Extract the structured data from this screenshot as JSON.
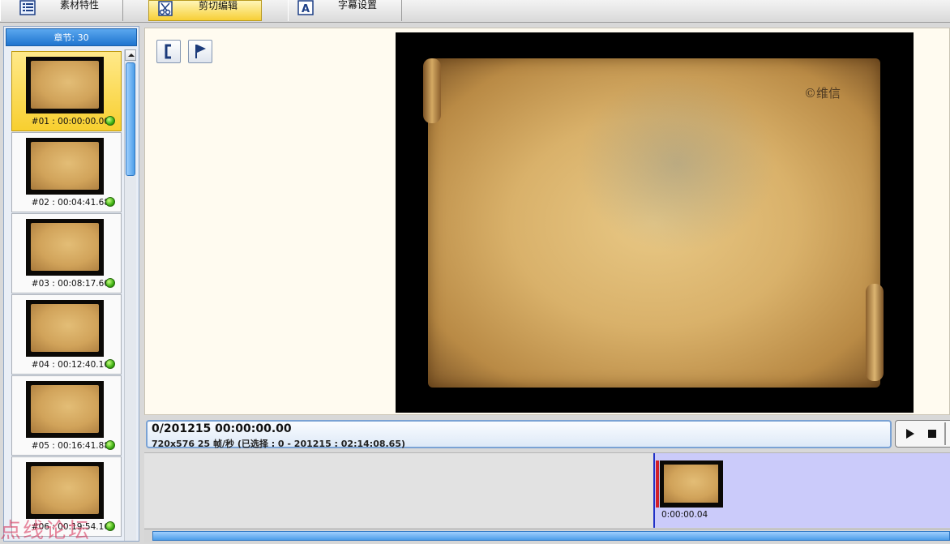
{
  "tabs": [
    {
      "label": "素材特性",
      "icon": "list-icon",
      "active": false
    },
    {
      "label": "剪切编辑",
      "icon": "scissors-edit-icon",
      "active": true
    },
    {
      "label": "字幕设置",
      "icon": "subtitle-a-icon",
      "active": false
    }
  ],
  "chapter_panel": {
    "header": "章节: 30",
    "items": [
      {
        "label": "#01 : 00:00:00.00",
        "selected": true
      },
      {
        "label": "#02 : 00:04:41.68",
        "selected": false
      },
      {
        "label": "#03 : 00:08:17.60",
        "selected": false
      },
      {
        "label": "#04 : 00:12:40.16",
        "selected": false
      },
      {
        "label": "#05 : 00:16:41.88",
        "selected": false
      },
      {
        "label": "#06 : 00:19:54.16",
        "selected": false
      }
    ]
  },
  "preview": {
    "tools": [
      {
        "icon": "mark-in-bracket-icon"
      },
      {
        "icon": "flag-icon"
      }
    ],
    "video_watermark": "©维信"
  },
  "info": {
    "frame_counter": "0/201215  00:00:00.00",
    "video_info": "720x576 25  帧/秒  (已选择 : 0 - 201215 : 02:14:08.65)"
  },
  "playback": {
    "buttons": [
      {
        "icon": "play-icon"
      },
      {
        "icon": "stop-icon"
      }
    ]
  },
  "timeline": {
    "clip_time": "0:00:00.04"
  },
  "overlay": {
    "forum_watermark": "点线论坛"
  },
  "colors": {
    "accent_tab": "#f7cf36",
    "selection_blue": "#1f74cf",
    "timeline_selection": "#cbcbfa",
    "playhead": "#2030c8",
    "status_green": "#3db012"
  }
}
